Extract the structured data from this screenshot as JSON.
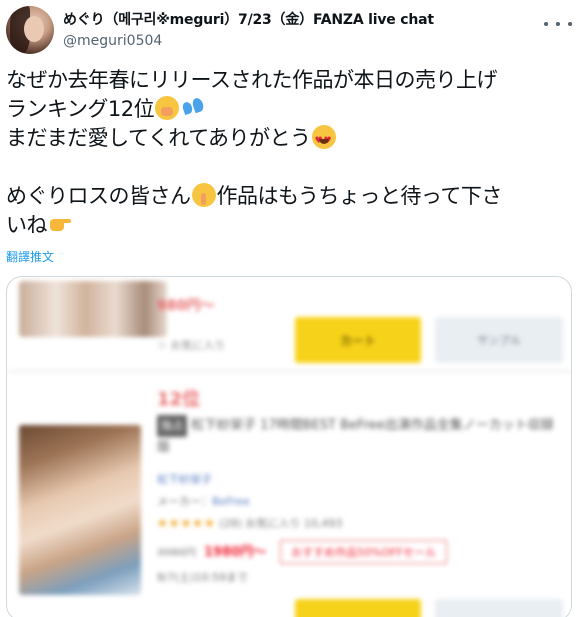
{
  "author": {
    "display_name": "めぐり（메구리※meguri）7/23（金）FANZA live chat",
    "handle": "@meguri0504"
  },
  "tweet": {
    "line1": "なぜか去年春にリリースされた作品が本日の売り上げ",
    "line2a": "ランキング12位",
    "line3a": "まだまだ愛してくれてありがとう",
    "line5a": "めぐりロスの皆さん",
    "line5b": "作品はもうちょっと待って下さ",
    "line6a": "いね",
    "emojis": [
      "hand-over-mouth-icon",
      "sweat-droplets-icon",
      "heart-eyes-icon",
      "shushing-face-icon",
      "pointing-hand-icon"
    ]
  },
  "translate_label": "翻譯推文",
  "card": {
    "top_price": "980円〜",
    "top_meta": "お気に入り",
    "cart_label": "カート",
    "sample_label": "サンプル",
    "rank": "12位",
    "badge": "独占",
    "title": "松下紗栄子 17時間BEST BeFree出演作品全集ノーカット収録版",
    "actress": "松下紗栄子",
    "maker_label": "メーカー：",
    "maker": "BeFree",
    "stars": "★★★★★",
    "reviews": "(28) お気に入り 10,493",
    "old_price": "3980円",
    "price": "1980円〜",
    "sale_banner": "おすすめ作品50%OFFセール",
    "date_line": "8/7(土)10:59まで"
  },
  "colors": {
    "link": "#1d9bf0",
    "secondary_text": "#536471",
    "cart_yellow": "#f7d21a",
    "price_red": "#e86b6b"
  }
}
